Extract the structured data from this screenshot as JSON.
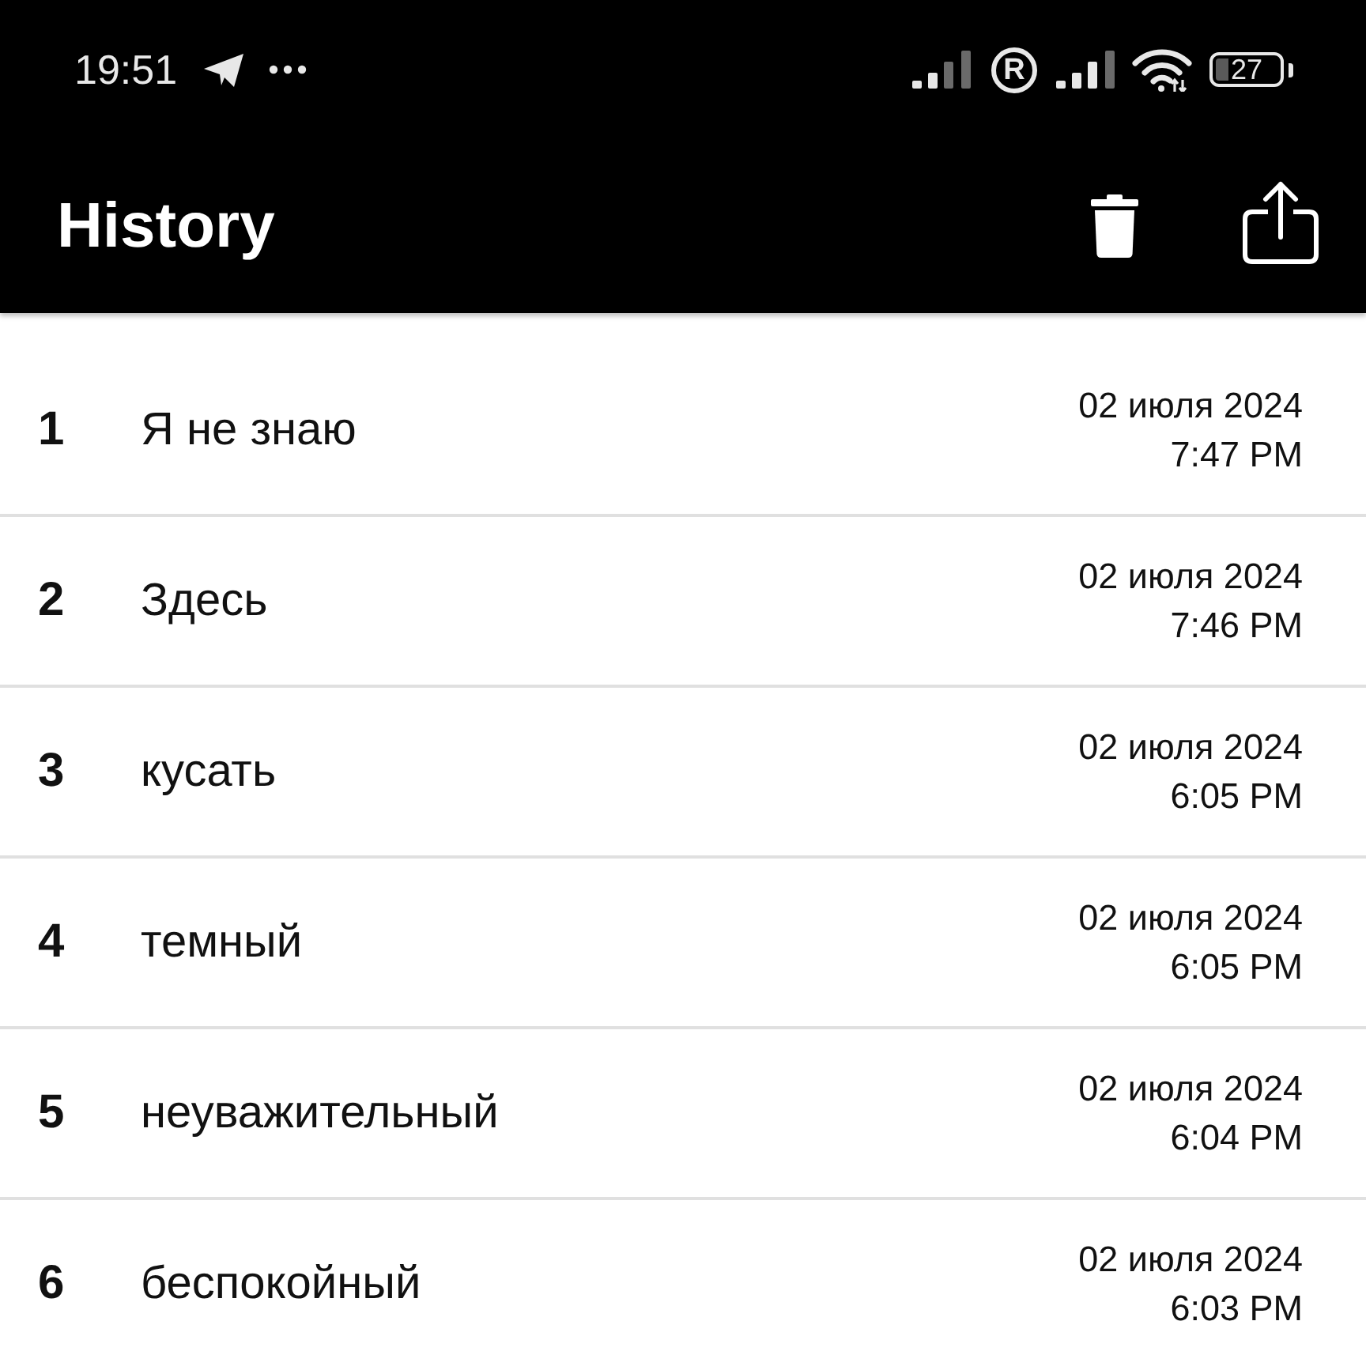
{
  "status_bar": {
    "time": "19:51",
    "roaming": "R",
    "battery": "27"
  },
  "app_bar": {
    "title": "History"
  },
  "history": [
    {
      "number": "1",
      "word": "Я не знаю",
      "date": "02 июля 2024",
      "time": "7:47 PM"
    },
    {
      "number": "2",
      "word": "Здесь",
      "date": "02 июля 2024",
      "time": "7:46 PM"
    },
    {
      "number": "3",
      "word": "кусать",
      "date": "02 июля 2024",
      "time": "6:05 PM"
    },
    {
      "number": "4",
      "word": "темный",
      "date": "02 июля 2024",
      "time": "6:05 PM"
    },
    {
      "number": "5",
      "word": "неуважительный",
      "date": "02 июля 2024",
      "time": "6:04 PM"
    },
    {
      "number": "6",
      "word": "беспокойный",
      "date": "02 июля 2024",
      "time": "6:03 PM"
    }
  ]
}
